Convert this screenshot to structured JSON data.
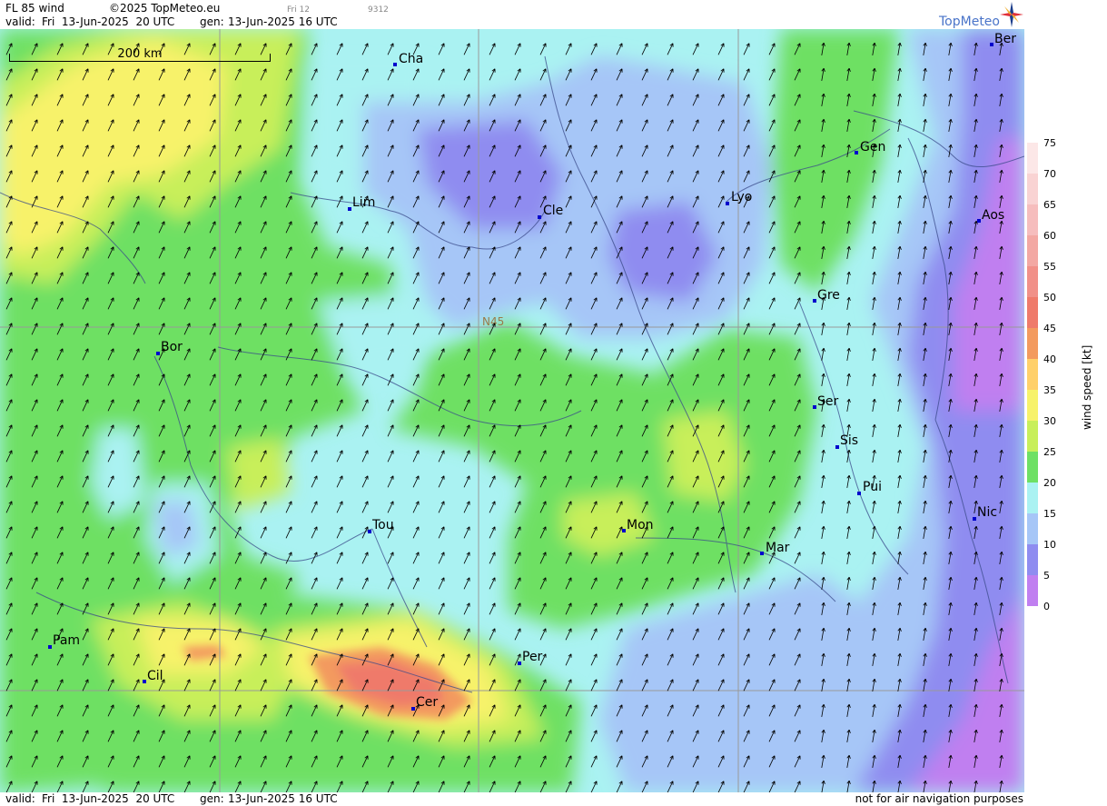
{
  "header": {
    "product": "FL 85 wind",
    "copyright": "©2025 TopMeteo.eu",
    "tab_day": "Fri 12",
    "code": "9312",
    "valid_label": "valid:",
    "valid_time": "Fri  13-Jun-2025  20 UTC",
    "gen_label": "gen:",
    "gen_time": "13-Jun-2025 16 UTC"
  },
  "logo": {
    "text": "TopMeteo",
    "icon": "compass-star-icon"
  },
  "map": {
    "scale_label": "200 km",
    "parallel_label": "N45",
    "colors": {
      "grid": "#999999",
      "city": "#0000cc",
      "river": "#3a4a8a"
    },
    "cities": [
      {
        "name": "Cha"
      },
      {
        "name": "Lim"
      },
      {
        "name": "Cle"
      },
      {
        "name": "Lyo"
      },
      {
        "name": "Gen"
      },
      {
        "name": "Ber"
      },
      {
        "name": "Aos"
      },
      {
        "name": "Gre"
      },
      {
        "name": "Bor"
      },
      {
        "name": "Ser"
      },
      {
        "name": "Sis"
      },
      {
        "name": "Pui"
      },
      {
        "name": "Tou"
      },
      {
        "name": "Mon"
      },
      {
        "name": "Mar"
      },
      {
        "name": "Nic"
      },
      {
        "name": "Pam"
      },
      {
        "name": "Cil"
      },
      {
        "name": "Per"
      },
      {
        "name": "Cer"
      }
    ]
  },
  "legend": {
    "title": "wind speed [kt]",
    "ticks": [
      "75",
      "70",
      "65",
      "60",
      "55",
      "50",
      "45",
      "40",
      "35",
      "30",
      "25",
      "20",
      "15",
      "10",
      "5",
      "0"
    ],
    "colors": [
      "#ffffff",
      "#fce7e7",
      "#f9d3d3",
      "#f6bdbd",
      "#f3a8a3",
      "#f19088",
      "#ef7a6a",
      "#f39a5e",
      "#ffd06a",
      "#f7f26a",
      "#c8ef5a",
      "#6ee064",
      "#aaf2f2",
      "#a6c6f7",
      "#8f8cf0",
      "#c07ff0"
    ]
  },
  "footer": {
    "valid_label": "valid:",
    "valid_time": "Fri  13-Jun-2025  20 UTC",
    "gen_label": "gen:",
    "gen_time": "13-Jun-2025 16 UTC",
    "note": "not for air navigation purposes"
  }
}
